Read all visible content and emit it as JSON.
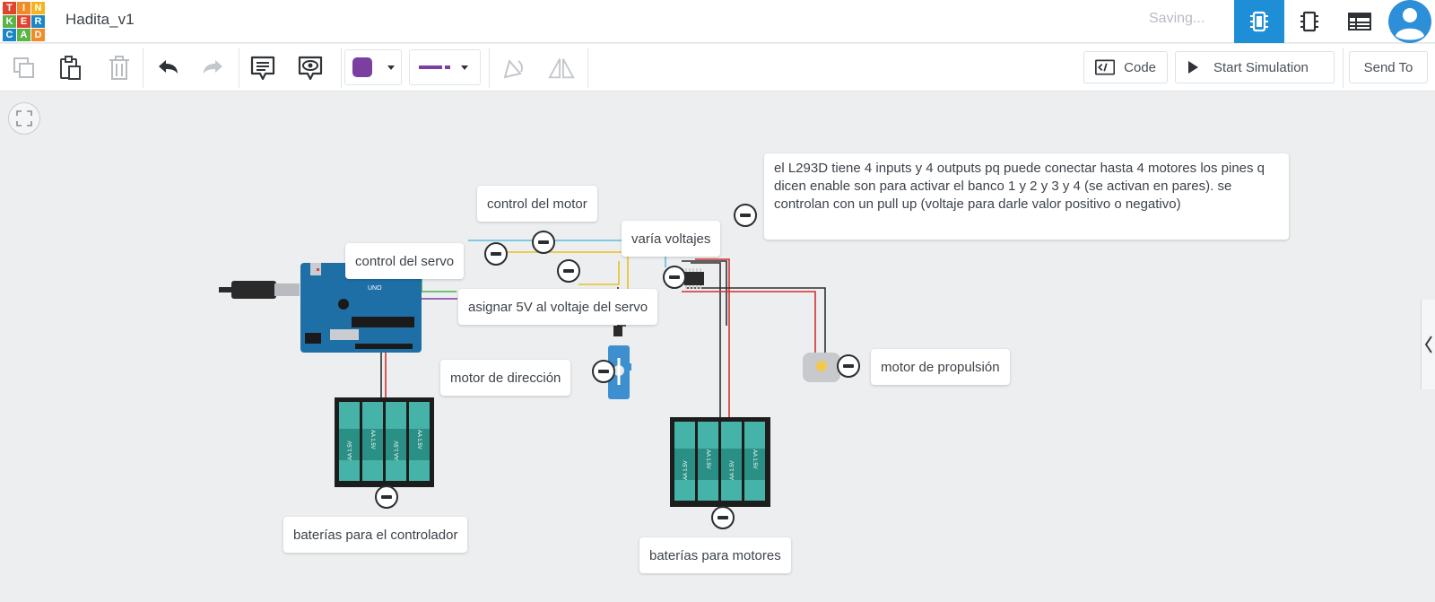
{
  "app": {
    "logo_letters": [
      "T",
      "I",
      "N",
      "K",
      "E",
      "R",
      "C",
      "A",
      "D"
    ],
    "project_title": "Hadita_v1",
    "save_status": "Saving..."
  },
  "header": {
    "view_buttons": [
      {
        "name": "circuit-view-icon",
        "active": true
      },
      {
        "name": "schematic-view-icon",
        "active": false
      },
      {
        "name": "component-list-icon",
        "active": false
      }
    ]
  },
  "toolbar": {
    "code_label": "Code",
    "start_simulation_label": "Start Simulation",
    "send_to_label": "Send To",
    "wire_color": "#7b3fa0",
    "accent_color": "#1e8ed7"
  },
  "notes": {
    "control_motor": "control del motor",
    "varia_voltajes": "varía voltajes",
    "control_servo": "control del servo",
    "asignar_5v": "asignar 5V al voltaje del servo",
    "motor_direccion": "motor de dirección",
    "motor_propulsion": "motor de propulsión",
    "baterias_controlador": "baterías para el controlador",
    "baterias_motores": "baterías para motores",
    "l293d_info": "el L293D tiene 4 inputs y 4 outputs pq puede conectar hasta 4 motores los pines q dicen enable son para activar el banco 1 y 2 y 3 y 4 (se activan en pares). se controlan con un pull up (voltaje para darle valor positivo o negativo)"
  },
  "components": {
    "battery_label": "AA 1.5V",
    "arduino_label": "UNO"
  }
}
